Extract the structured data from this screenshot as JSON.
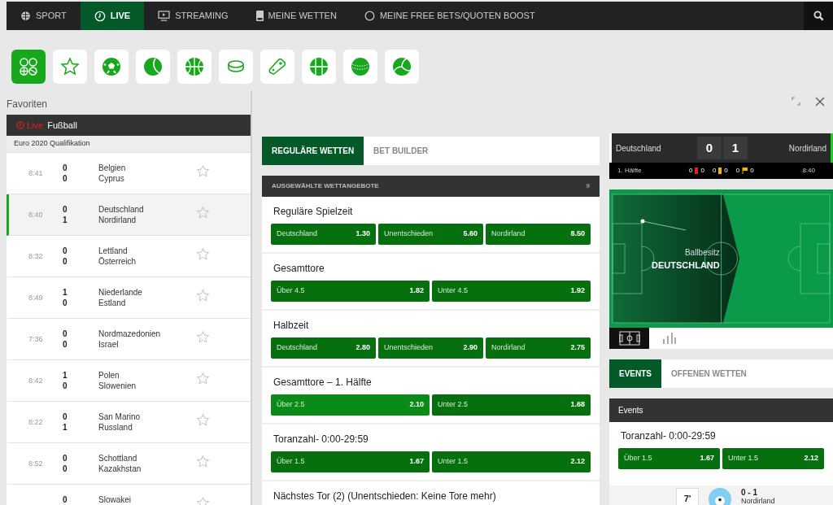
{
  "nav": [
    {
      "kind": "globe",
      "label": "SPORT",
      "selected": false
    },
    {
      "kind": "clock",
      "label": "LIVE",
      "selected": true
    },
    {
      "kind": "monitor",
      "label": "STREAMING",
      "selected": false
    },
    {
      "kind": "slip",
      "label": "MEINE WETTEN",
      "selected": false
    },
    {
      "kind": "ring",
      "label": "MEINE FREE BETS/QUOTEN BOOST",
      "selected": false
    }
  ],
  "sports": [
    {
      "kind": "all",
      "selected": true
    },
    {
      "kind": "favorites",
      "selected": false
    },
    {
      "kind": "football",
      "selected": false
    },
    {
      "kind": "tennis",
      "selected": false
    },
    {
      "kind": "basketball",
      "selected": false
    },
    {
      "kind": "hockey",
      "selected": false
    },
    {
      "kind": "esports",
      "selected": false
    },
    {
      "kind": "handball",
      "selected": false
    },
    {
      "kind": "cricket",
      "selected": false
    },
    {
      "kind": "volleyball",
      "selected": false
    }
  ],
  "favorites": {
    "title": "Favoriten",
    "live_label": "Live",
    "sport": "Fußball",
    "competition": "Euro 2020 Qualifikation",
    "matches": [
      {
        "time": "8:41",
        "scores": [
          "0",
          "0"
        ],
        "teams": [
          "Belgien",
          "Cyprus"
        ],
        "selected": false
      },
      {
        "time": "8:40",
        "scores": [
          "0",
          "1"
        ],
        "teams": [
          "Deutschland",
          "Nordirland"
        ],
        "selected": true
      },
      {
        "time": "8:32",
        "scores": [
          "0",
          "0"
        ],
        "teams": [
          "Lettland",
          "Österreich"
        ],
        "selected": false
      },
      {
        "time": "8:49",
        "scores": [
          "1",
          "0"
        ],
        "teams": [
          "Niederlande",
          "Estland"
        ],
        "selected": false
      },
      {
        "time": "7:36",
        "scores": [
          "0",
          "0"
        ],
        "teams": [
          "Nordmazedonien",
          "Israel"
        ],
        "selected": false
      },
      {
        "time": "8:42",
        "scores": [
          "1",
          "0"
        ],
        "teams": [
          "Polen",
          "Slowenien"
        ],
        "selected": false
      },
      {
        "time": "8:22",
        "scores": [
          "0",
          "1"
        ],
        "teams": [
          "San Marino",
          "Russland"
        ],
        "selected": false
      },
      {
        "time": "8:52",
        "scores": [
          "0",
          "0"
        ],
        "teams": [
          "Schottland",
          "Kazakhstan"
        ],
        "selected": false
      },
      {
        "scores": [
          "0"
        ],
        "teams": [
          "Slowakei"
        ],
        "selected": false
      }
    ]
  },
  "bet_tabs": [
    {
      "label": "REGULÄRE WETTEN",
      "selected": true
    },
    {
      "label": "BET BUILDER",
      "selected": false
    }
  ],
  "markets_header": {
    "title": "AUSGEWÄHLTE WETTANGEBOTE",
    "count": "9"
  },
  "markets": [
    {
      "title": "Reguläre Spielzeit",
      "odds": [
        {
          "label": "Deutschland",
          "price": "1.30",
          "highlighted": false
        },
        {
          "label": "Unentschieden",
          "price": "5.60",
          "highlighted": false
        },
        {
          "label": "Nordirland",
          "price": "8.50",
          "highlighted": false
        }
      ]
    },
    {
      "title": "Gesamttore",
      "odds": [
        {
          "label": "Über 4.5",
          "price": "1.82",
          "highlighted": false
        },
        {
          "label": "Unter 4.5",
          "price": "1.92",
          "highlighted": false
        }
      ]
    },
    {
      "title": "Halbzeit",
      "odds": [
        {
          "label": "Deutschland",
          "price": "2.80",
          "highlighted": false
        },
        {
          "label": "Unentschieden",
          "price": "2.90",
          "highlighted": false
        },
        {
          "label": "Nordirland",
          "price": "2.75",
          "highlighted": false
        }
      ]
    },
    {
      "title": "Gesamttore – 1. Hälfte",
      "odds": [
        {
          "label": "Über 2.5",
          "price": "2.10",
          "highlighted": true
        },
        {
          "label": "Unter 2.5",
          "price": "1.68",
          "highlighted": false
        }
      ]
    },
    {
      "title": "Toranzahl- 0:00-29:59",
      "odds": [
        {
          "label": "Über 1.5",
          "price": "1.67",
          "highlighted": false
        },
        {
          "label": "Unter 1.5",
          "price": "2.12",
          "highlighted": false
        }
      ]
    },
    {
      "title": "Nächstes Tor (2) (Unentschieden: Keine Tore mehr)"
    }
  ],
  "scoreboard": {
    "home": "Deutschland",
    "away": "Nordirland",
    "home_score": "0",
    "away_score": "1",
    "period": "1. Hälfte",
    "clock": "8:40",
    "stats": [
      {
        "kind": "red_card",
        "home": "0",
        "away": "0"
      },
      {
        "kind": "yellow_card",
        "home": "0",
        "away": "0"
      },
      {
        "kind": "corner",
        "home": "0",
        "away": "0"
      }
    ]
  },
  "pitch": {
    "caption": "Ballbesitz",
    "team": "DEUTSCHLAND"
  },
  "view_tabs": [
    {
      "kind": "pitch",
      "selected": true
    },
    {
      "kind": "stats",
      "selected": false
    }
  ],
  "event_tabs": [
    {
      "label": "EVENTS",
      "selected": true
    },
    {
      "label": "OFFENEN WETTEN",
      "selected": false
    }
  ],
  "events": {
    "title": "Events",
    "market": {
      "title": "Toranzahl- 0:00-29:59",
      "odds": [
        {
          "label": "Über 1.5",
          "price": "1.67"
        },
        {
          "label": "Unter 1.5",
          "price": "2.12"
        }
      ]
    },
    "items": [
      {
        "minute": "7'",
        "score": "0 - 1",
        "team": "Nordirland"
      }
    ]
  }
}
